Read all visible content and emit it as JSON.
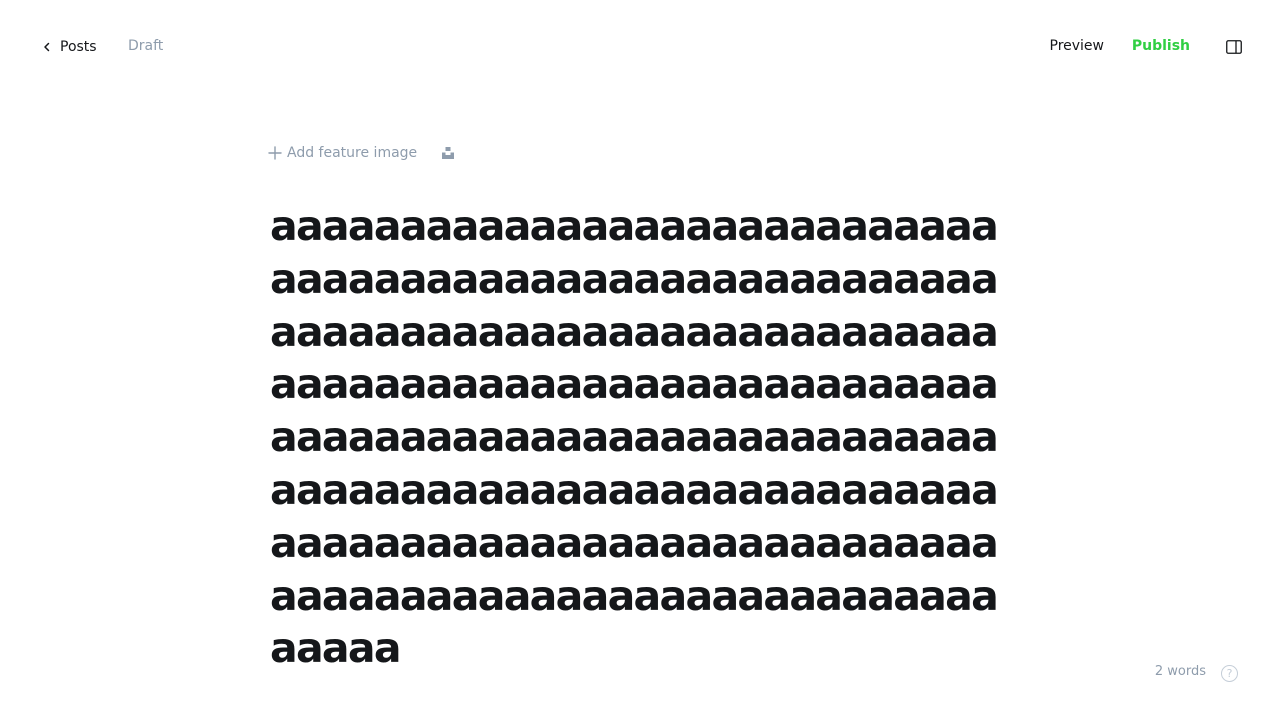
{
  "header": {
    "back_label": "Posts",
    "status": "Draft",
    "preview_label": "Preview",
    "publish_label": "Publish",
    "publish_color": "#30cf43"
  },
  "editor": {
    "add_feature_image_label": "Add feature image",
    "title": "aaaaaaaaaaaaaaaaaaaaaaaaaaaaaaaaaaaaaaaaaaaaaaaaaaaaaaaaaaaaaaaaaaaaaaaaaaaaaaaaaaaaaaaaaaaaaaaaaaaaaaaaaaaaaaaaaaaaaaaaaaaaaaaaaaaaaaaaaaaaaaaaaaaaaaaaaaaaaaaaaaaaaaaaaaaaaaaaaaaaaaaaaaaaaaaaaaaaaaaaaaaaaaaaaaaaaaaaaaaaaaaaaaaaa"
  },
  "footer": {
    "word_count": "2 words",
    "help_label": "?"
  },
  "icons": {
    "back": "chevron-left-icon",
    "add": "plus-icon",
    "unsplash": "unsplash-icon",
    "sidebar": "sidebar-toggle-icon",
    "help": "question-mark-icon"
  }
}
